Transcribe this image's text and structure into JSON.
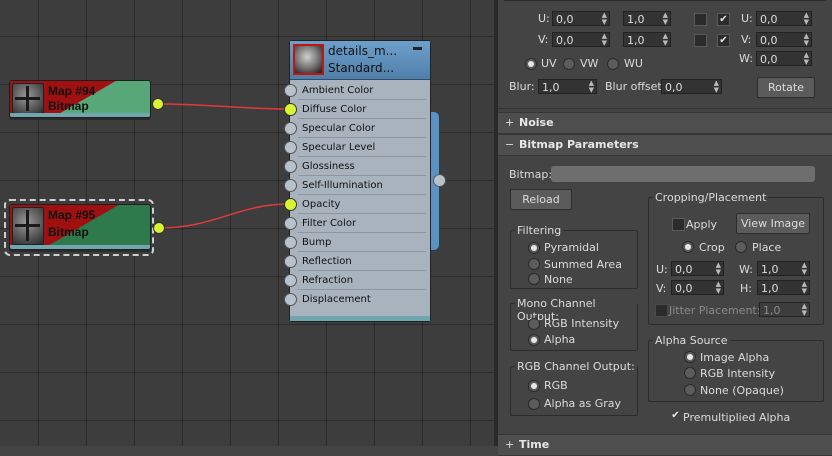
{
  "editor": {
    "map94": {
      "title": "Map #94",
      "type": "Bitmap"
    },
    "map95": {
      "title": "Map #95",
      "type": "Bitmap"
    },
    "material": {
      "title_line1": "details_m...",
      "title_line2": "Standard...",
      "slots": [
        "Ambient Color",
        "Diffuse Color",
        "Specular Color",
        "Specular Level",
        "Glossiness",
        "Self-Illumination",
        "Opacity",
        "Filter Color",
        "Bump",
        "Reflection",
        "Refraction",
        "Displacement"
      ]
    }
  },
  "coords": {
    "u1": "U:",
    "u1_val": "0,0",
    "u2_val": "1,0",
    "v1": "V:",
    "v1_val": "0,0",
    "v2_val": "1,0",
    "u3": "U:",
    "u3_val": "0,0",
    "v3": "V:",
    "v3_val": "0,0",
    "w3": "W:",
    "w3_val": "0,0",
    "check_mark": "✔",
    "uv": "UV",
    "vw": "VW",
    "wu": "WU",
    "blur": "Blur:",
    "blur_val": "1,0",
    "blur_offset": "Blur offset:",
    "blur_offset_val": "0,0",
    "rotate": "Rotate"
  },
  "rollouts": {
    "noise": {
      "sign": "+",
      "label": "Noise"
    },
    "bitmap_params": {
      "sign": "−",
      "label": "Bitmap Parameters"
    },
    "time": {
      "sign": "+",
      "label": "Time"
    }
  },
  "bitmap": {
    "bitmap_label": "Bitmap:",
    "reload": "Reload",
    "filtering": {
      "title": "Filtering",
      "options": [
        "Pyramidal",
        "Summed Area",
        "None"
      ]
    },
    "mono": {
      "title": "Mono Channel Output:",
      "options": [
        "RGB Intensity",
        "Alpha"
      ]
    },
    "rgb": {
      "title": "RGB Channel Output:",
      "options": [
        "RGB",
        "Alpha as Gray"
      ]
    },
    "cropping": {
      "title": "Cropping/Placement",
      "apply": "Apply",
      "view_image": "View Image",
      "crop": "Crop",
      "place": "Place",
      "u": "U:",
      "u_val": "0,0",
      "w": "W:",
      "w_val": "1,0",
      "v": "V:",
      "v_val": "0,0",
      "h": "H:",
      "h_val": "1,0",
      "jitter": "Jitter Placement:",
      "jitter_val": "1,0"
    },
    "alpha": {
      "title": "Alpha Source",
      "options": [
        "Image Alpha",
        "RGB Intensity",
        "None (Opaque)"
      ]
    },
    "premult": "Premultiplied Alpha"
  }
}
